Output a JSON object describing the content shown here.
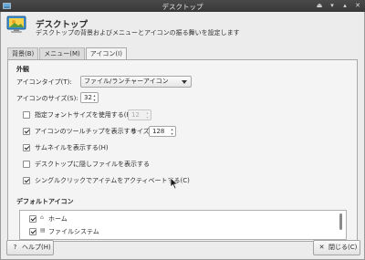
{
  "window": {
    "title": "デスクトップ",
    "controls": [
      "shade",
      "minimize",
      "maximize",
      "close"
    ]
  },
  "header": {
    "title": "デスクトップ",
    "subtitle": "デスクトップの背景およびメニューとアイコンの振る舞いを設定します"
  },
  "tabs": [
    {
      "label": "背景(B)",
      "active": false
    },
    {
      "label": "メニュー(M)",
      "active": false
    },
    {
      "label": "アイコン(I)",
      "active": true
    }
  ],
  "appearance": {
    "section_label": "外観",
    "icon_type_label": "アイコンタイプ(T):",
    "icon_type_value": "ファイル/ランチャーアイコン",
    "icon_size_label": "アイコンのサイズ(S):",
    "icon_size_value": "32",
    "custom_font": {
      "label": "指定フォントサイズを使用する(F):",
      "checked": false,
      "value": "12"
    },
    "tooltips": {
      "label": "アイコンのツールチップを表示する",
      "checked": true,
      "size_label": "サイズ:",
      "size_value": "128"
    },
    "thumbnails": {
      "label": "サムネイルを表示する(H)",
      "checked": true
    },
    "hidden_files": {
      "label": "デスクトップに隠しファイルを表示する",
      "checked": false
    },
    "single_click": {
      "label": "シングルクリックでアイテムをアクティベートする(C)",
      "checked": true
    }
  },
  "default_icons": {
    "section_label": "デフォルトアイコン",
    "items": [
      {
        "label": "ホーム",
        "checked": true,
        "icon": "home-icon"
      },
      {
        "label": "ファイルシステム",
        "checked": true,
        "icon": "drive-icon"
      }
    ]
  },
  "footer": {
    "help_label": "ヘルプ(H)",
    "close_label": "閉じる(C)"
  }
}
